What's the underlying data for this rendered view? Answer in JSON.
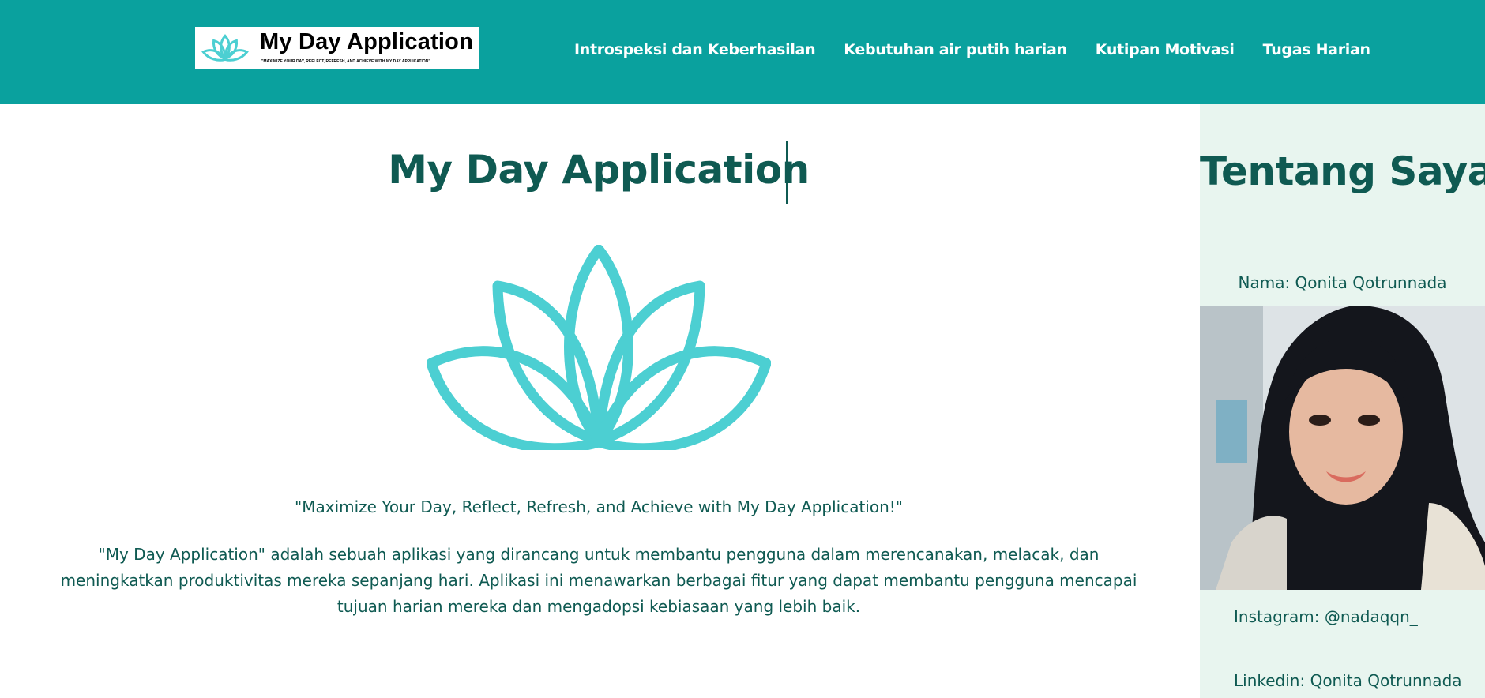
{
  "header": {
    "logo": {
      "title": "My Day Application",
      "tagline": "\"Maximize Your Day, Reflect, Refresh, and Achieve with My Day Application\"",
      "icon": "lotus-icon"
    },
    "nav": [
      {
        "label": "Introspeksi dan Keberhasilan"
      },
      {
        "label": "Kebutuhan air putih harian"
      },
      {
        "label": "Kutipan Motivasi"
      },
      {
        "label": "Tugas Harian"
      }
    ]
  },
  "main": {
    "title": "My Day Application",
    "tagline": "\"Maximize Your Day, Reflect, Refresh, and Achieve with My Day Application!\"",
    "description": "\"My Day Application\" adalah sebuah aplikasi yang dirancang untuk membantu pengguna dalam merencanakan, melacak, dan meningkatkan produktivitas mereka sepanjang hari. Aplikasi ini menawarkan berbagai fitur yang dapat membantu pengguna mencapai tujuan harian mereka dan mengadopsi kebiasaan yang lebih baik."
  },
  "sidebar": {
    "title": "Tentang Saya",
    "name": "Nama: Qonita Qotrunnada",
    "instagram": "Instagram: @nadaqqn_",
    "linkedin": "Linkedin: Qonita Qotrunnada"
  },
  "colors": {
    "header_bg": "#0aa19e",
    "text_dark_green": "#0f5a52",
    "sidebar_bg": "#e8f5ef",
    "lotus": "#4ccfd2"
  }
}
